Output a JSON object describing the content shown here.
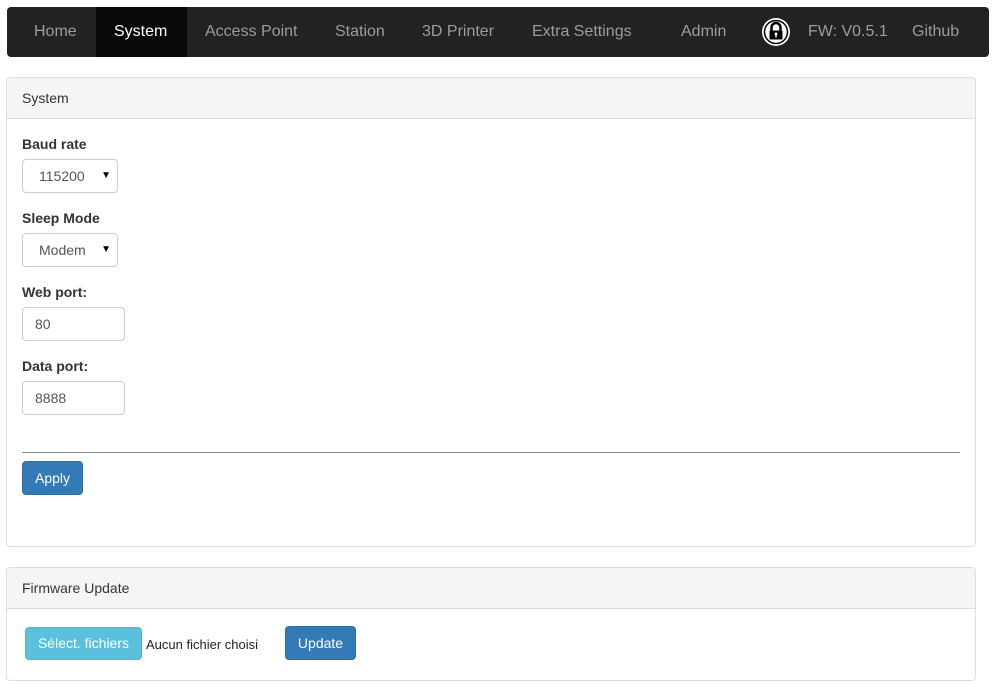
{
  "navbar": {
    "items": [
      {
        "label": "Home"
      },
      {
        "label": "System"
      },
      {
        "label": "Access Point"
      },
      {
        "label": "Station"
      },
      {
        "label": "3D Printer"
      },
      {
        "label": "Extra Settings"
      },
      {
        "label": "Admin"
      }
    ],
    "lock_icon": "lock-icon",
    "firmware": "FW: V0.5.1",
    "github": "Github",
    "colors": {
      "background": "#222222",
      "active_background": "#080808",
      "text": "#9d9d9d",
      "active_text": "#ffffff"
    }
  },
  "system_panel": {
    "heading": "System",
    "baud_rate": {
      "label": "Baud rate",
      "value": "115200"
    },
    "sleep_mode": {
      "label": "Sleep Mode",
      "value": "Modem"
    },
    "web_port": {
      "label": "Web port:",
      "value": "80"
    },
    "data_port": {
      "label": "Data port:",
      "value": "8888"
    },
    "apply_label": "Apply"
  },
  "firmware_panel": {
    "heading": "Firmware Update",
    "choose_label": "Sélect. fichiers",
    "no_file_text": "Aucun fichier choisi",
    "update_label": "Update"
  },
  "colors": {
    "primary": "#337ab7",
    "info": "#5bc0de",
    "panel_heading": "#f5f5f5"
  }
}
